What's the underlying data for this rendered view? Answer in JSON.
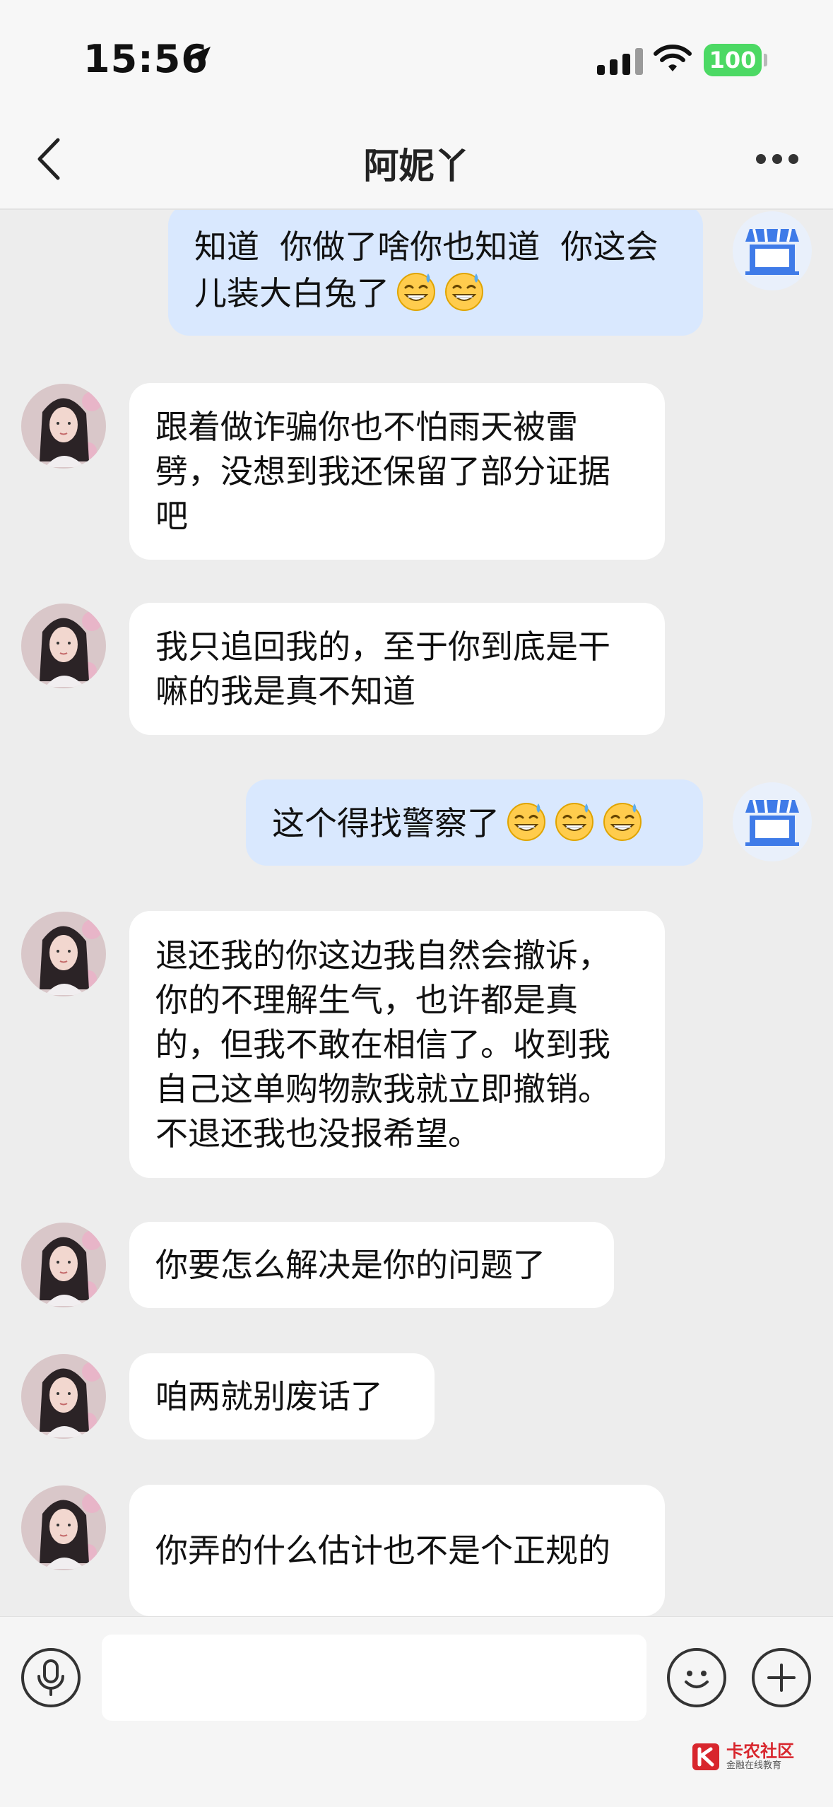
{
  "status_bar": {
    "time": "15:56",
    "battery": "100"
  },
  "header": {
    "title": "阿妮丫",
    "icons": [
      "back-chevron-icon",
      "more-dots-icon"
    ]
  },
  "messages": [
    {
      "side": "out",
      "text": "知道  你做了啥你也知道  你这会儿装大白兔了",
      "emoji_count": 2
    },
    {
      "side": "in",
      "text": "跟着做诈骗你也不怕雨天被雷劈，没想到我还保留了部分证据吧",
      "emoji_count": 0
    },
    {
      "side": "in",
      "text": "我只追回我的，至于你到底是干嘛的我是真不知道",
      "emoji_count": 0
    },
    {
      "side": "out",
      "text": "这个得找警察了",
      "emoji_count": 3
    },
    {
      "side": "in",
      "text": "退还我的你这边我自然会撤诉，你的不理解生气，也许都是真的，但我不敢在相信了。收到我自己这单购物款我就立即撤销。不退还我也没报希望。",
      "emoji_count": 0
    },
    {
      "side": "in",
      "text": "你要怎么解决是你的问题了",
      "emoji_count": 0
    },
    {
      "side": "in",
      "text": "咱两就别废话了",
      "emoji_count": 0
    },
    {
      "side": "in",
      "text": "你弄的什么估计也不是个正规的",
      "emoji_count": 0
    }
  ],
  "input_bar": {
    "placeholder": "",
    "icons": [
      "microphone-icon",
      "emoji-smile-icon",
      "plus-icon"
    ]
  },
  "watermark": {
    "title": "卡农社区",
    "subtitle": "金融在线教育"
  },
  "colors": {
    "incoming_bubble": "#ffffff",
    "outgoing_bubble": "#d9e8fe",
    "background": "#ededed",
    "battery": "#4cd964",
    "watermark_red": "#d8262d"
  }
}
